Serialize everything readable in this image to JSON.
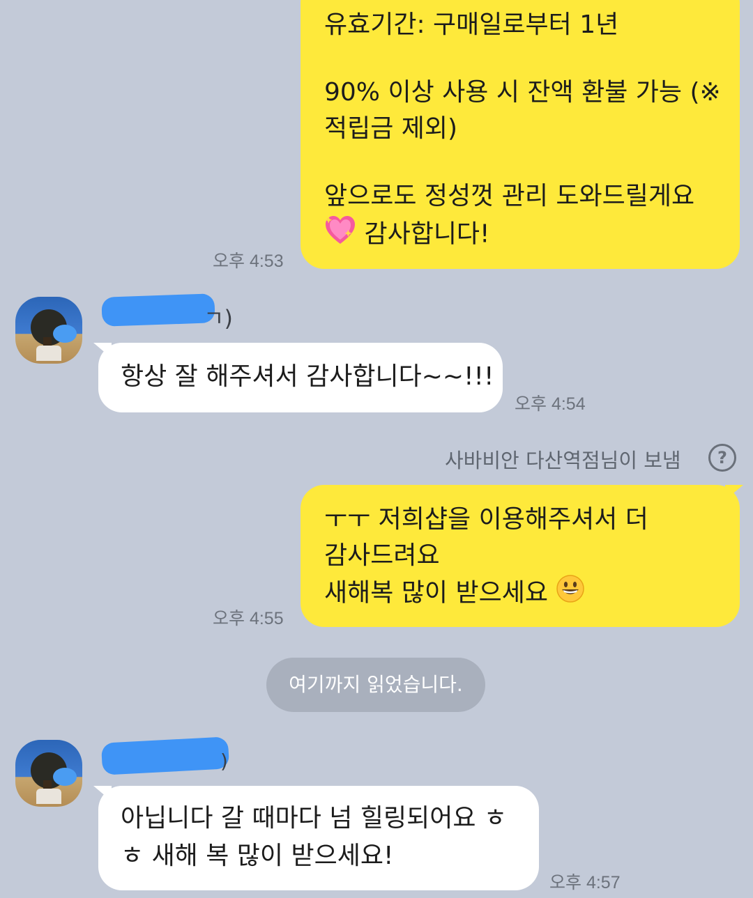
{
  "messages": {
    "m1": {
      "lines": [
        "유효기간: 구매일로부터 1년",
        "90% 이상 사용 시 잔액 환불 가능 (※",
        "적립금 제외)",
        "앞으로도 정성껏 관리 도와드릴게요",
        "감사합니다!"
      ],
      "emoji": "sparkling-heart",
      "time": "오후 4:53"
    },
    "m2": {
      "sender_suffix": "ㄱ)",
      "lines": [
        "항상 잘 해주셔서 감사합니다~~!!!"
      ],
      "time": "오후 4:54"
    },
    "m3": {
      "sent_by_note": "사바비안 다산역점님이 보냄",
      "help_symbol": "?",
      "lines": [
        "ㅜㅜ 저희샵을 이용해주셔서 더",
        "감사드려요",
        "새해복 많이 받으세요"
      ],
      "emoji": "grinning-face",
      "time": "오후 4:55"
    },
    "read_marker": "여기까지 읽었습니다.",
    "m4": {
      "sender_suffix": ")",
      "lines": [
        "아닙니다 갈 때마다 넘 힐링되어요 ㅎ",
        "ㅎ 새해 복 많이 받으세요!"
      ],
      "time": "오후 4:57"
    }
  },
  "colors": {
    "background": "#c3cad8",
    "outgoing_bubble": "#fee93b",
    "incoming_bubble": "#ffffff",
    "name_redaction": "#3f94f6",
    "read_pill": "#a9b0bd"
  }
}
